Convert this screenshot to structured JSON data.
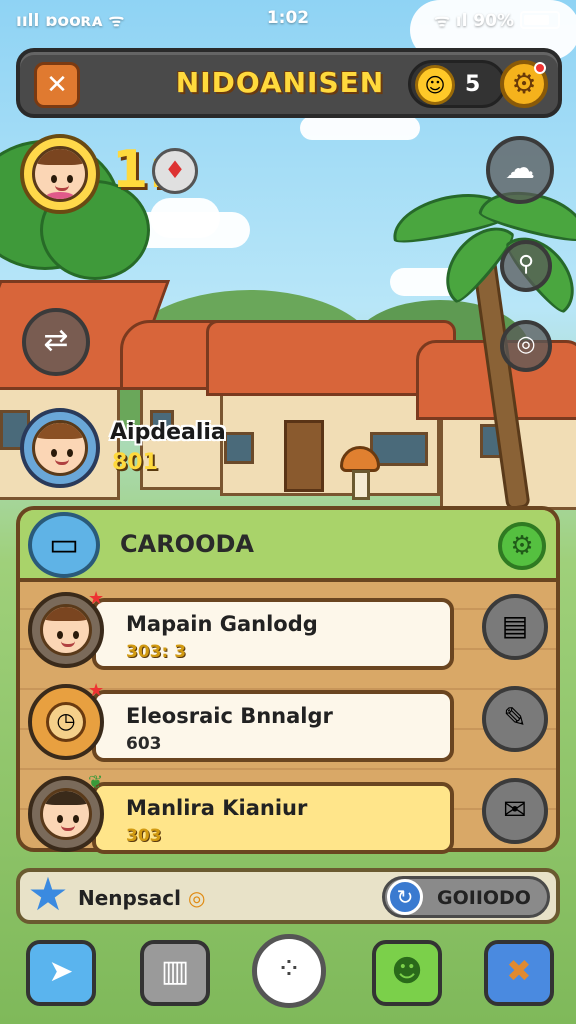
{
  "status_bar": {
    "left": "ııll ɒᴏᴏʀᴀ ᯤ",
    "time": "1:02",
    "right": "ᯤ ıl 90%"
  },
  "top_bar": {
    "menu_icon": "crossed-swords-icon",
    "title": "NIDOANISEN",
    "coins": "5",
    "settings_icon": "gear-icon"
  },
  "player": {
    "level": "1:",
    "gem_icon": "gem-icon"
  },
  "friend": {
    "name": "Aipdealia",
    "score": "801"
  },
  "panel": {
    "title": "CAROODA",
    "rows": [
      {
        "name": "Mapain Ganlodg",
        "score": "303: 3",
        "action_icon": "notebook-icon",
        "highlight": false
      },
      {
        "name": "Eleosraic Bnnalgr",
        "score": "603",
        "action_icon": "feather-icon",
        "highlight": false
      },
      {
        "name": "Manlira Kianiur",
        "score": "303",
        "action_icon": "mail-icon",
        "highlight": true
      }
    ]
  },
  "info_bar": {
    "label": "Nenpsacl",
    "coin": "◎",
    "right_label": "GOIIODO"
  },
  "colors": {
    "accent": "#ffd93d",
    "panel": "#d9a867",
    "header": "#a9d36a",
    "highlight": "#ffe58a"
  }
}
